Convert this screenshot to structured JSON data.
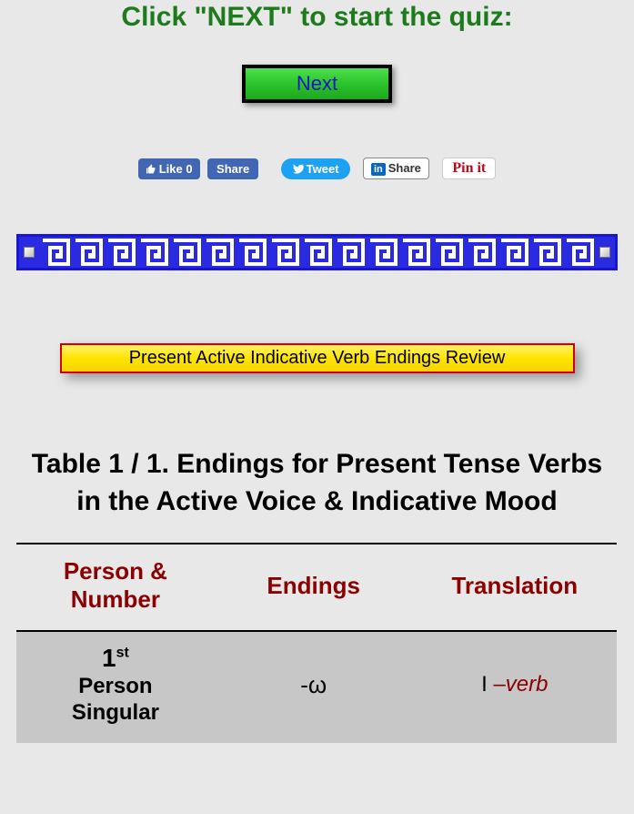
{
  "heading": "Click \"NEXT\" to start the quiz:",
  "next_label": "Next",
  "social": {
    "fb_like": "Like 0",
    "fb_share": "Share",
    "tweet": "Tweet",
    "li_share": "Share",
    "li_in": "in",
    "pinit": "Pin it"
  },
  "review_banner": "Present Active Indicative Verb Endings Review",
  "table_title": "Table 1 / 1. Endings for Present Tense Verbs in the Active Voice & Indicative Mood",
  "table": {
    "headers": {
      "col1_line1": "Person &",
      "col1_line2": "Number",
      "col2": "Endings",
      "col3": "Translation"
    },
    "rows": [
      {
        "ord_num": "1",
        "ord_suffix": "st",
        "pn_line1": "Person",
        "pn_line2": "Singular",
        "ending": "-ω",
        "trans_pre": "I ",
        "trans_dash": "–",
        "trans_verb": "verb"
      }
    ]
  }
}
